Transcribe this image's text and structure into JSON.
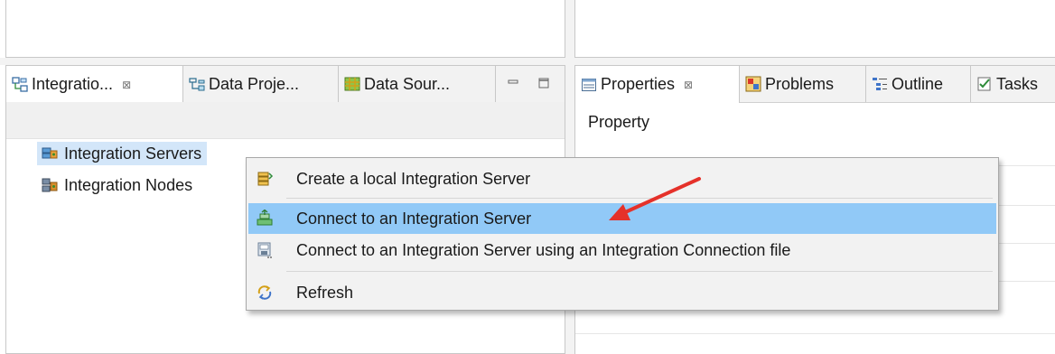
{
  "left_tabs": [
    {
      "label": "Integratio...",
      "icon": "integration-explorer-icon",
      "active": true,
      "close": "⊠"
    },
    {
      "label": "Data Proje...",
      "icon": "data-project-icon",
      "active": false
    },
    {
      "label": "Data Sour...",
      "icon": "data-source-icon",
      "active": false
    }
  ],
  "right_tabs": [
    {
      "label": "Properties",
      "icon": "properties-icon",
      "active": true,
      "close": "⊠"
    },
    {
      "label": "Problems",
      "icon": "problems-icon",
      "active": false
    },
    {
      "label": "Outline",
      "icon": "outline-icon",
      "active": false
    },
    {
      "label": "Tasks",
      "icon": "tasks-icon",
      "active": false
    }
  ],
  "tree": {
    "items": [
      {
        "label": "Integration Servers",
        "icon": "integration-servers-icon",
        "selected": true
      },
      {
        "label": "Integration Nodes",
        "icon": "integration-nodes-icon",
        "selected": false
      }
    ]
  },
  "properties": {
    "header": "Property"
  },
  "context_menu": {
    "items": [
      {
        "label": "Create a local Integration Server",
        "icon": "create-server-icon"
      },
      {
        "label": "Connect to an Integration Server",
        "icon": "connect-server-icon",
        "highlighted": true
      },
      {
        "label": "Connect to an Integration Server using an Integration Connection file",
        "icon": "connection-file-icon"
      },
      {
        "label": "Refresh",
        "icon": "refresh-icon"
      }
    ]
  },
  "annotation": {
    "arrow_color": "#e5312a"
  },
  "colors": {
    "selection": "#d3e6f9",
    "menu_highlight": "#91c9f7"
  }
}
